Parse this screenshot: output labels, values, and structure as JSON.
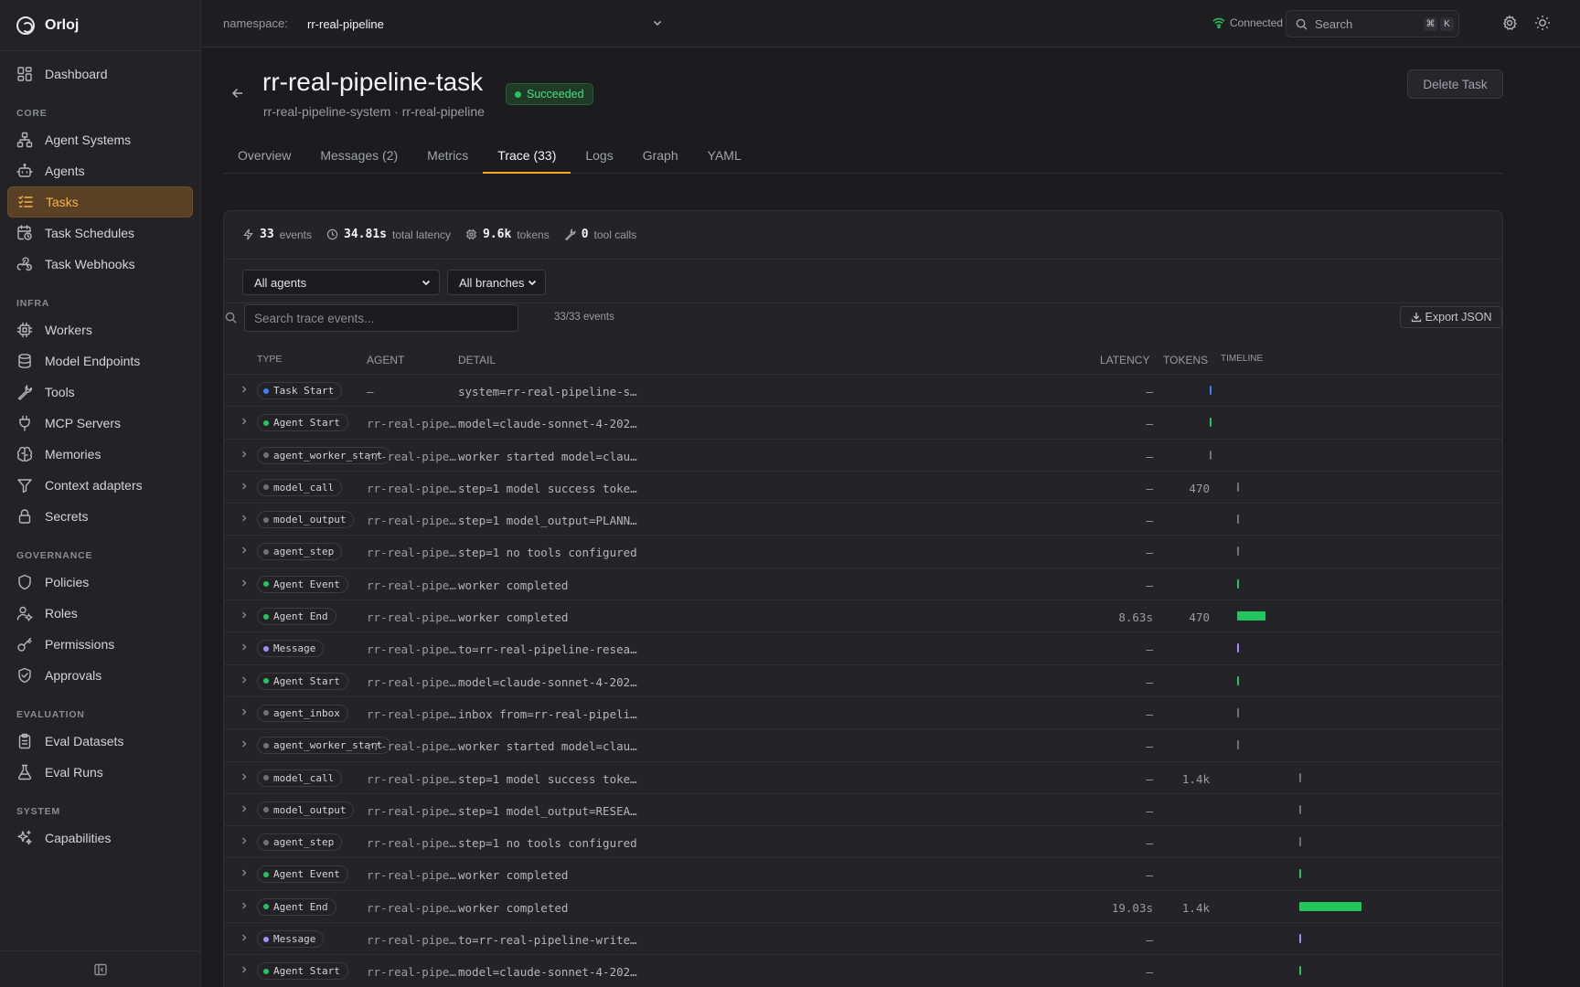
{
  "app": {
    "name": "Orloj"
  },
  "sidebar": {
    "top": [
      {
        "label": "Dashboard",
        "icon": "dashboard-icon"
      }
    ],
    "sections": [
      {
        "title": "CORE",
        "items": [
          {
            "label": "Agent Systems",
            "icon": "agent-systems-icon"
          },
          {
            "label": "Agents",
            "icon": "bot-icon"
          },
          {
            "label": "Tasks",
            "icon": "tasks-icon",
            "active": true
          },
          {
            "label": "Task Schedules",
            "icon": "calendar-clock-icon"
          },
          {
            "label": "Task Webhooks",
            "icon": "webhook-icon"
          }
        ]
      },
      {
        "title": "INFRA",
        "items": [
          {
            "label": "Workers",
            "icon": "cpu-icon"
          },
          {
            "label": "Model Endpoints",
            "icon": "database-icon"
          },
          {
            "label": "Tools",
            "icon": "wrench-icon"
          },
          {
            "label": "MCP Servers",
            "icon": "plug-icon"
          },
          {
            "label": "Memories",
            "icon": "brain-icon"
          },
          {
            "label": "Context adapters",
            "icon": "filter-icon"
          },
          {
            "label": "Secrets",
            "icon": "lock-icon"
          }
        ]
      },
      {
        "title": "GOVERNANCE",
        "items": [
          {
            "label": "Policies",
            "icon": "shield-icon"
          },
          {
            "label": "Roles",
            "icon": "user-cog-icon"
          },
          {
            "label": "Permissions",
            "icon": "key-icon"
          },
          {
            "label": "Approvals",
            "icon": "shield-check-icon"
          }
        ]
      },
      {
        "title": "EVALUATION",
        "items": [
          {
            "label": "Eval Datasets",
            "icon": "clipboard-list-icon"
          },
          {
            "label": "Eval Runs",
            "icon": "flask-icon"
          }
        ]
      },
      {
        "title": "SYSTEM",
        "items": [
          {
            "label": "Capabilities",
            "icon": "sparkles-icon"
          }
        ]
      }
    ]
  },
  "topbar": {
    "namespace_label": "namespace:",
    "namespace_value": "rr-real-pipeline",
    "connection": "Connected",
    "search_placeholder": "Search",
    "kbd1": "⌘",
    "kbd2": "K"
  },
  "task": {
    "title": "rr-real-pipeline-task",
    "status": "Succeeded",
    "subtitle": "rr-real-pipeline-system · rr-real-pipeline",
    "delete_label": "Delete Task"
  },
  "tabs": [
    {
      "label": "Overview"
    },
    {
      "label": "Messages (2)"
    },
    {
      "label": "Metrics"
    },
    {
      "label": "Trace (33)",
      "active": true
    },
    {
      "label": "Logs"
    },
    {
      "label": "Graph"
    },
    {
      "label": "YAML"
    }
  ],
  "trace": {
    "stats": {
      "events_value": "33",
      "events_label": "events",
      "latency_value": "34.81s",
      "latency_label": "total latency",
      "tokens_value": "9.6k",
      "tokens_label": "tokens",
      "tools_value": "0",
      "tools_label": "tool calls"
    },
    "agent_filter": "All agents",
    "branch_filter": "All branches",
    "search_placeholder": "Search trace events...",
    "event_count": "33/33 events",
    "export_label": "Export JSON",
    "columns": {
      "type": "TYPE",
      "agent": "AGENT",
      "detail": "DETAIL",
      "latency": "LATENCY",
      "tokens": "TOKENS",
      "timeline": "TIMELINE"
    },
    "colors": {
      "blue": "#3b82f6",
      "green": "#22c55e",
      "gray": "#71717a",
      "purple": "#a78bfa"
    },
    "rows": [
      {
        "type": "Task Start",
        "dot": "blue",
        "agent": "–",
        "detail": "system=rr-real-pipeline-system ...",
        "latency": "–",
        "tokens": "",
        "tl_start": 0.0,
        "tl_width": 0.004,
        "tl_color": "blue"
      },
      {
        "type": "Agent Start",
        "dot": "green",
        "agent": "rr-real-pipel…",
        "detail": "model=claude-sonnet-4-20250...",
        "latency": "–",
        "tokens": "",
        "tl_start": 0.0,
        "tl_width": 0.004,
        "tl_color": "green"
      },
      {
        "type": "agent_worker_start",
        "dot": "gray",
        "agent": "rr-real-pipel…",
        "detail": "worker started model=claude-so...",
        "latency": "–",
        "tokens": "",
        "tl_start": 0.0,
        "tl_width": 0.004,
        "tl_color": "gray"
      },
      {
        "type": "model_call",
        "dot": "gray",
        "agent": "rr-real-pipel…",
        "detail": "step=1 model success tokens=4...",
        "latency": "–",
        "tokens": "470",
        "tl_start": 0.18,
        "tl_width": 0.004,
        "tl_color": "gray"
      },
      {
        "type": "model_output",
        "dot": "gray",
        "agent": "rr-real-pipel…",
        "detail": "step=1 model_output=PLANNER_...",
        "latency": "–",
        "tokens": "",
        "tl_start": 0.18,
        "tl_width": 0.004,
        "tl_color": "gray"
      },
      {
        "type": "agent_step",
        "dot": "gray",
        "agent": "rr-real-pipel…",
        "detail": "step=1 no tools configured",
        "latency": "–",
        "tokens": "",
        "tl_start": 0.18,
        "tl_width": 0.004,
        "tl_color": "gray"
      },
      {
        "type": "Agent Event",
        "dot": "green",
        "agent": "rr-real-pipel…",
        "detail": "worker completed",
        "latency": "–",
        "tokens": "",
        "tl_start": 0.18,
        "tl_width": 0.004,
        "tl_color": "green"
      },
      {
        "type": "Agent End",
        "dot": "green",
        "agent": "rr-real-pipel…",
        "detail": "worker completed",
        "latency": "8.63s",
        "tokens": "470",
        "tl_start": 0.18,
        "tl_width": 0.19,
        "tl_color": "green"
      },
      {
        "type": "Message",
        "dot": "purple",
        "agent": "rr-real-pipel…",
        "detail": "to=rr-real-pipeline-research-age...",
        "latency": "–",
        "tokens": "",
        "tl_start": 0.18,
        "tl_width": 0.004,
        "tl_color": "purple"
      },
      {
        "type": "Agent Start",
        "dot": "green",
        "agent": "rr-real-pipel…",
        "detail": "model=claude-sonnet-4-20250...",
        "latency": "–",
        "tokens": "",
        "tl_start": 0.18,
        "tl_width": 0.004,
        "tl_color": "green"
      },
      {
        "type": "agent_inbox",
        "dot": "gray",
        "agent": "rr-real-pipel…",
        "detail": "inbox from=rr-real-pipeline-plan...",
        "latency": "–",
        "tokens": "",
        "tl_start": 0.18,
        "tl_width": 0.004,
        "tl_color": "gray"
      },
      {
        "type": "agent_worker_start",
        "dot": "gray",
        "agent": "rr-real-pipel…",
        "detail": "worker started model=claude-so...",
        "latency": "–",
        "tokens": "",
        "tl_start": 0.18,
        "tl_width": 0.004,
        "tl_color": "gray"
      },
      {
        "type": "model_call",
        "dot": "gray",
        "agent": "rr-real-pipel…",
        "detail": "step=1 model success tokens=1...",
        "latency": "–",
        "tokens": "1.4k",
        "tl_start": 0.59,
        "tl_width": 0.004,
        "tl_color": "gray"
      },
      {
        "type": "model_output",
        "dot": "gray",
        "agent": "rr-real-pipel…",
        "detail": "step=1 model_output=RESEARC...",
        "latency": "–",
        "tokens": "",
        "tl_start": 0.59,
        "tl_width": 0.004,
        "tl_color": "gray"
      },
      {
        "type": "agent_step",
        "dot": "gray",
        "agent": "rr-real-pipel…",
        "detail": "step=1 no tools configured",
        "latency": "–",
        "tokens": "",
        "tl_start": 0.59,
        "tl_width": 0.004,
        "tl_color": "gray"
      },
      {
        "type": "Agent Event",
        "dot": "green",
        "agent": "rr-real-pipel…",
        "detail": "worker completed",
        "latency": "–",
        "tokens": "",
        "tl_start": 0.59,
        "tl_width": 0.004,
        "tl_color": "green"
      },
      {
        "type": "Agent End",
        "dot": "green",
        "agent": "rr-real-pipel…",
        "detail": "worker completed",
        "latency": "19.03s",
        "tokens": "1.4k",
        "tl_start": 0.59,
        "tl_width": 0.41,
        "tl_color": "green"
      },
      {
        "type": "Message",
        "dot": "purple",
        "agent": "rr-real-pipel…",
        "detail": "to=rr-real-pipeline-writer-agent ...",
        "latency": "–",
        "tokens": "",
        "tl_start": 0.59,
        "tl_width": 0.004,
        "tl_color": "purple"
      },
      {
        "type": "Agent Start",
        "dot": "green",
        "agent": "rr-real-pipel…",
        "detail": "model=claude-sonnet-4-20250...",
        "latency": "–",
        "tokens": "",
        "tl_start": 0.59,
        "tl_width": 0.004,
        "tl_color": "green"
      }
    ]
  }
}
